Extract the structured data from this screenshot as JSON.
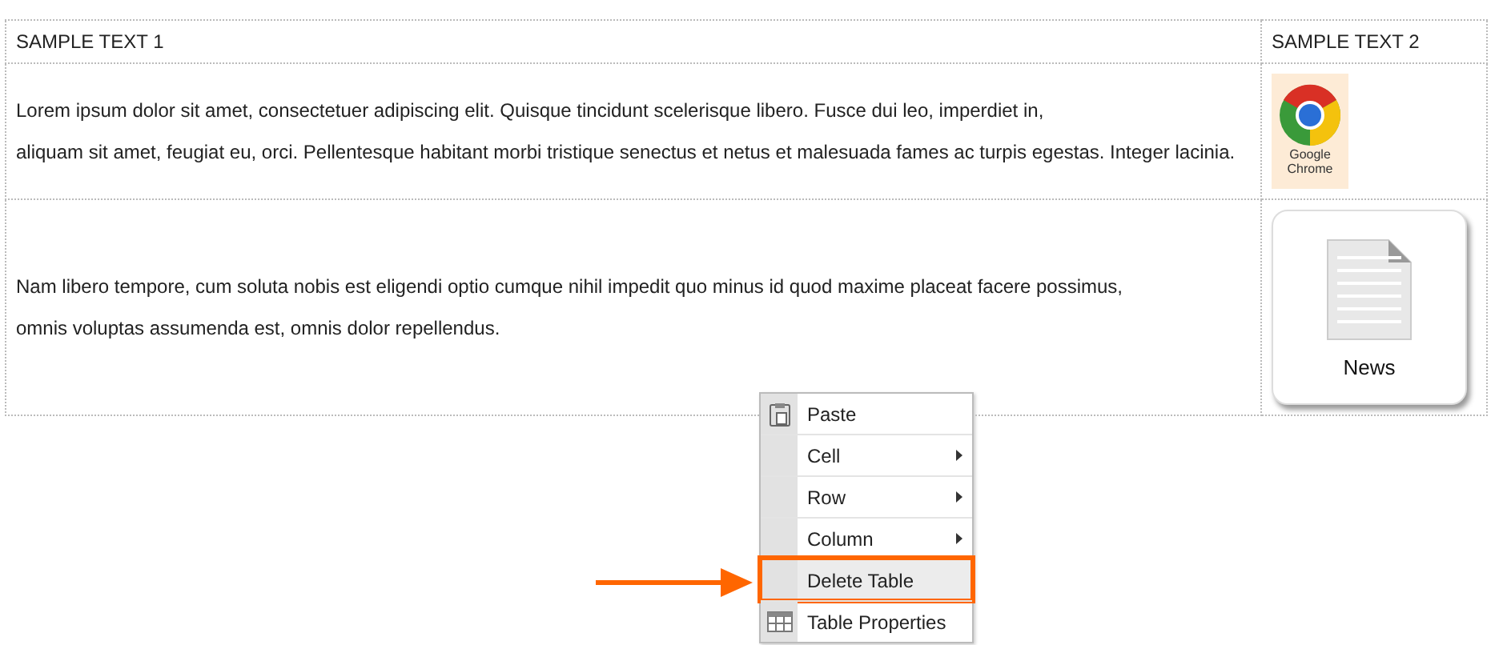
{
  "table": {
    "columns": [
      "SAMPLE TEXT 1",
      "SAMPLE TEXT 2"
    ],
    "rows": [
      {
        "lines": [
          "Lorem ipsum dolor sit amet, consectetuer adipiscing elit. Quisque tincidunt scelerisque libero. Fusce dui leo, imperdiet in,",
          "aliquam sit amet, feugiat eu, orci. Pellentesque habitant morbi tristique senectus et netus et malesuada fames ac turpis egestas. Integer lacinia."
        ],
        "tile": {
          "kind": "browser-logo",
          "caption": "Google Chrome"
        }
      },
      {
        "lines": [
          "Nam libero tempore, cum soluta nobis est eligendi optio cumque nihil impedit quo minus id quod maxime placeat facere possimus,",
          "omnis voluptas assumenda est, omnis dolor repellendus."
        ],
        "tile": {
          "kind": "document",
          "caption": "News"
        }
      }
    ]
  },
  "context_menu": {
    "items": [
      {
        "label": "Paste",
        "kind": "paste",
        "selected": false
      },
      {
        "label": "Cell",
        "kind": "submenu",
        "selected": false
      },
      {
        "label": "Row",
        "kind": "submenu",
        "selected": false
      },
      {
        "label": "Column",
        "kind": "submenu",
        "selected": false
      },
      {
        "label": "Delete Table",
        "kind": "action",
        "selected": true
      },
      {
        "label": "Table Properties",
        "kind": "properties",
        "selected": false
      }
    ]
  }
}
